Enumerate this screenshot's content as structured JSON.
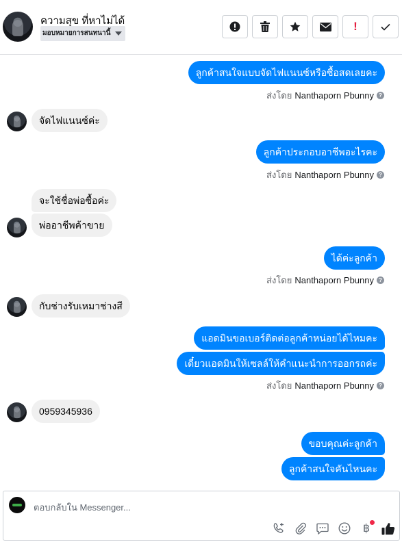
{
  "header": {
    "contact_name": "ความสุข ที่หาไม่ได้",
    "assign_label": "มอบหมายการสนทนานี้",
    "toolbar": [
      {
        "name": "spam-button",
        "icon": "exclamation-circle-icon"
      },
      {
        "name": "delete-button",
        "icon": "trash-icon"
      },
      {
        "name": "star-button",
        "icon": "star-icon"
      },
      {
        "name": "mark-unread-button",
        "icon": "envelope-icon"
      },
      {
        "name": "follow-up-button",
        "icon": "exclamation-icon",
        "label": "!"
      },
      {
        "name": "mark-done-button",
        "icon": "check-icon"
      }
    ]
  },
  "messages": {
    "m1": "ลูกค้าสนใจแบบจัดไฟแนนซ์หรือซื้อสดเลยคะ",
    "m2": "จัดไฟแนนซ์ค่ะ",
    "m3": "ลูกค้าประกอบอาชีพอะไรคะ",
    "m4": "จะใช้ชื่อพ่อซื้อค่ะ",
    "m5": "พ่ออาชีพค้าขาย",
    "m6": "ได้ค่ะลูกค้า",
    "m7": "กับช่างรับเหมาช่างสี",
    "m8": "แอดมินขอเบอร์ติดต่อลูกค้าหน่อยได้ไหมคะ",
    "m9": "เดี๋ยวแอดมินให้เซลล์ให้คำแนะนำการออกรถค่ะ",
    "m10": "0959345936",
    "m11": "ขอบคุณค่ะลูกค้า",
    "m12": "ลูกค้าสนใจคันไหนคะ"
  },
  "sent_by": {
    "prefix": "ส่งโดย",
    "agent": "Nanthaporn Pbunny",
    "help": "?"
  },
  "composer": {
    "placeholder": "ตอบกลับใน Messenger...",
    "tools": [
      "phone-plus-icon",
      "paperclip-icon",
      "chat-bubble-icon",
      "smiley-icon",
      "baht-icon",
      "like-icon"
    ],
    "baht_symbol": "฿"
  },
  "colors": {
    "outgoing_bubble": "#0084ff",
    "incoming_bubble": "#f0f0f0",
    "notification_dot": "#f02849"
  }
}
